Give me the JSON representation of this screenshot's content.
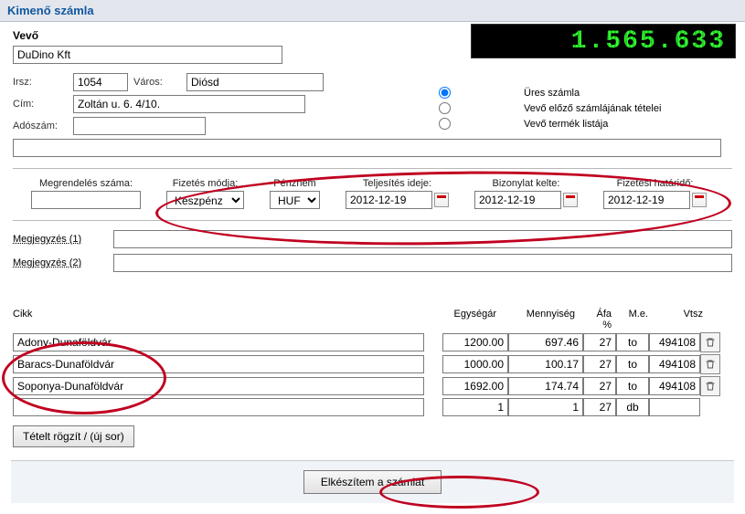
{
  "title": "Kimenő számla",
  "counter": "1.565.633",
  "buyer": {
    "label": "Vevő",
    "name": "DuDino Kft",
    "irsz_label": "Irsz:",
    "irsz": "1054",
    "varos_label": "Város:",
    "varos": "Diósd",
    "cim_label": "Cím:",
    "cim": "Zoltán u. 6. 4/10.",
    "adoszam_label": "Adószám:",
    "adoszam": ""
  },
  "options": {
    "o1": "Üres számla",
    "o2": "Vevő előző számlájának tételei",
    "o3": "Vevő termék listája",
    "selected": 0
  },
  "headers": {
    "megrend": "Megrendelés száma:",
    "fizmod": "Fizetés módja:",
    "penznem": "Pénznem",
    "telj": "Teljesítés ideje:",
    "kelte": "Bizonylat kelte:",
    "hatar": "Fizetési határidő:"
  },
  "values": {
    "megrend": "",
    "fizmod": "Készpénz",
    "penznem": "HUF",
    "telj": "2012-12-19",
    "kelte": "2012-12-19",
    "hatar": "2012-12-19"
  },
  "notes": {
    "l1": "Megjegyzés (1)",
    "l2": "Megjegyzés (2)",
    "v1": "",
    "v2": ""
  },
  "item_headers": {
    "cikk": "Cikk",
    "egy": "Egységár",
    "menny": "Mennyiség",
    "afa": "Áfa %",
    "me": "M.e.",
    "vtsz": "Vtsz"
  },
  "items": [
    {
      "name": "Adony-Dunaföldvár",
      "egy": "1200.00",
      "menny": "697.46",
      "afa": "27",
      "me": "to",
      "vtsz": "494108"
    },
    {
      "name": "Baracs-Dunaföldvár",
      "egy": "1000.00",
      "menny": "100.17",
      "afa": "27",
      "me": "to",
      "vtsz": "494108"
    },
    {
      "name": "Soponya-Dunaföldvár",
      "egy": "1692.00",
      "menny": "174.74",
      "afa": "27",
      "me": "to",
      "vtsz": "494108"
    },
    {
      "name": "",
      "egy": "1",
      "menny": "1",
      "afa": "27",
      "me": "db",
      "vtsz": ""
    }
  ],
  "buttons": {
    "add_row": "Tételt rögzít / (új sor)",
    "submit": "Elkészítem a számlát"
  }
}
